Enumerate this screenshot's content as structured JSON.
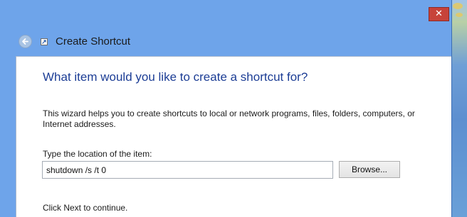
{
  "window": {
    "title": "Create Shortcut",
    "close_glyph": "✕"
  },
  "wizard": {
    "heading": "What item would you like to create a shortcut for?",
    "description": "This wizard helps you to create shortcuts to local or network programs, files, folders, computers, or Internet addresses.",
    "location_label": "Type the location of the item:",
    "location_value": "shutdown /s /t 0",
    "browse_label": "Browse...",
    "continue_text": "Click Next to continue."
  },
  "icons": {
    "back": "back-arrow-icon",
    "wizard": "shortcut-wizard-icon",
    "close": "close-icon"
  },
  "colors": {
    "window_frame": "#6ea4ea",
    "heading_text": "#1c3d95",
    "close_button": "#c7433a"
  }
}
